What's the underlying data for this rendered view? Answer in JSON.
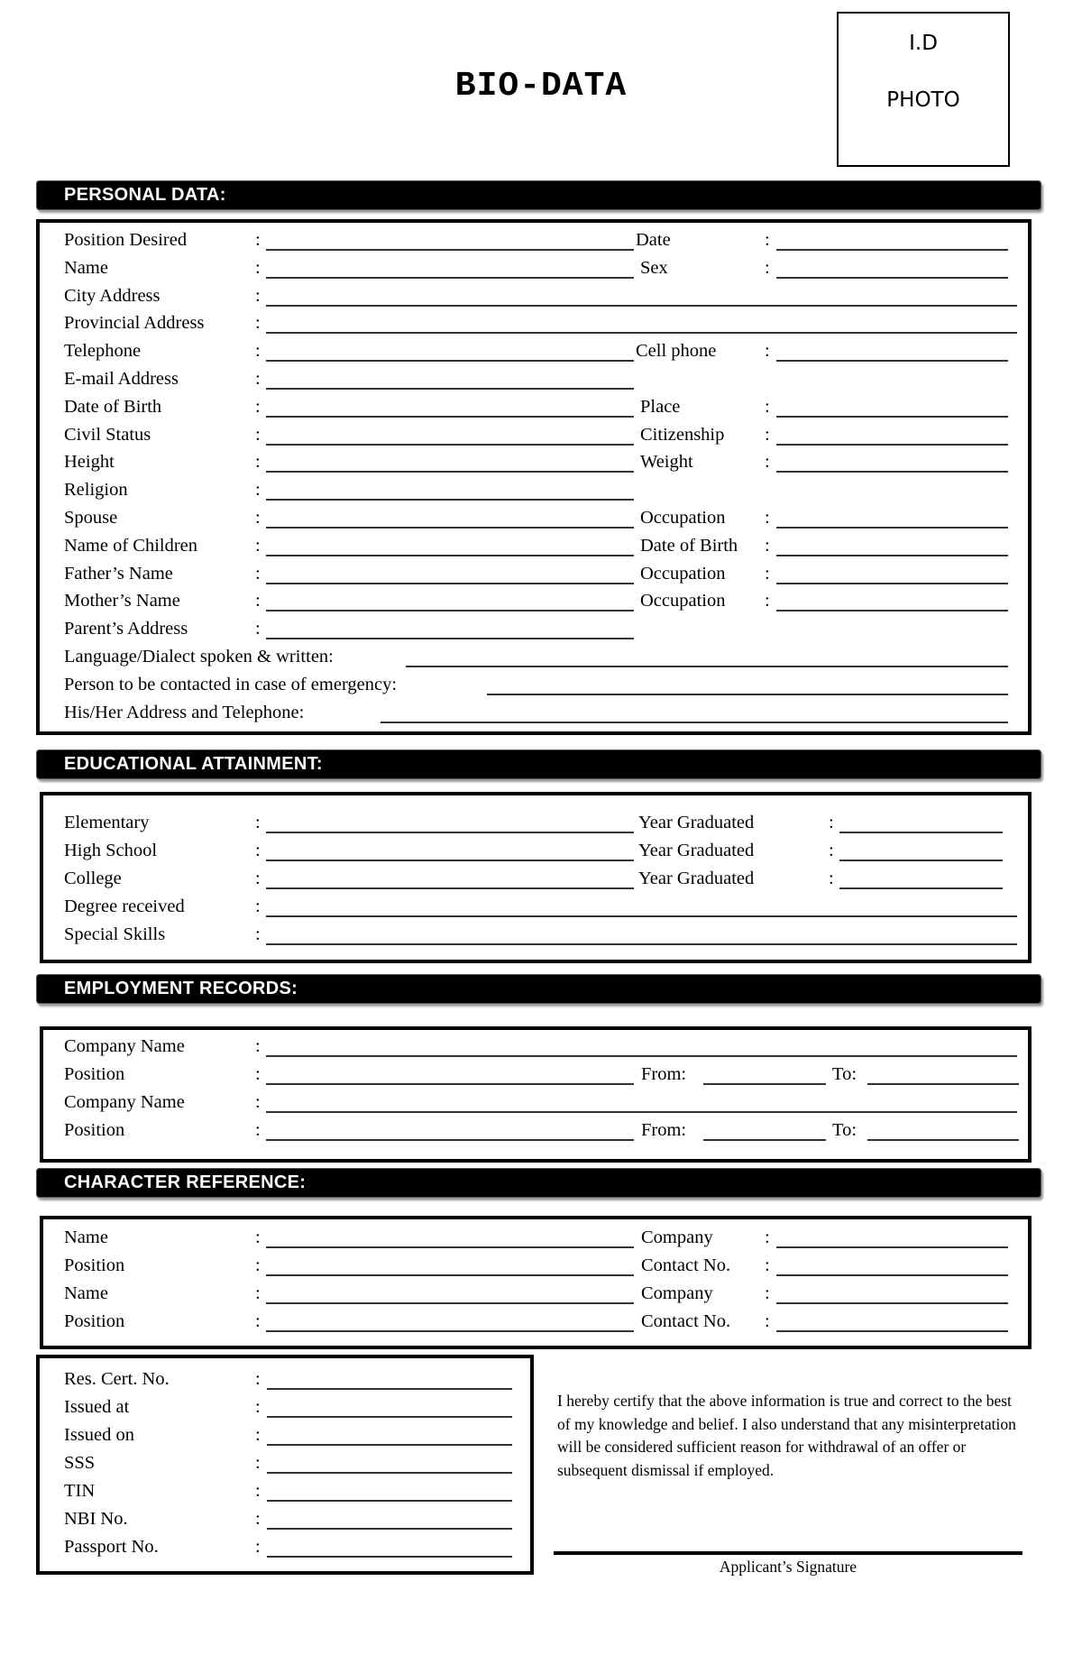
{
  "header": {
    "title": "BIO-DATA",
    "photo_line1": "I.D",
    "photo_line2": "PHOTO"
  },
  "sections": {
    "personal": "PERSONAL DATA:",
    "education": "EDUCATIONAL ATTAINMENT:",
    "employment": "EMPLOYMENT RECORDS:",
    "character": "CHARACTER REFERENCE:"
  },
  "personal": {
    "rows": [
      {
        "left": "Position Desired",
        "right": "Date"
      },
      {
        "left": "Name",
        "right": "Sex"
      },
      {
        "left": "City Address",
        "right": null
      },
      {
        "left": "Provincial Address",
        "right": null
      },
      {
        "left": "Telephone",
        "right": "Cell phone"
      },
      {
        "left": "E-mail Address",
        "right": null
      },
      {
        "left": "Date of Birth",
        "right": "Place"
      },
      {
        "left": "Civil Status",
        "right": "Citizenship"
      },
      {
        "left": "Height",
        "right": "Weight"
      },
      {
        "left": "Religion",
        "right": null
      },
      {
        "left": "Spouse",
        "right": "Occupation"
      },
      {
        "left": "Name of Children",
        "right": "Date of Birth"
      },
      {
        "left": "Father’s Name",
        "right": "Occupation"
      },
      {
        "left": "Mother’s Name",
        "right": "Occupation"
      },
      {
        "left": "Parent’s Address",
        "right": null
      }
    ],
    "long_rows": [
      "Language/Dialect spoken & written:",
      "Person to be contacted in case of emergency:",
      "His/Her Address and Telephone:"
    ]
  },
  "education": {
    "rows": [
      {
        "left": "Elementary",
        "right": "Year Graduated"
      },
      {
        "left": "High School",
        "right": "Year Graduated"
      },
      {
        "left": "College",
        "right": "Year Graduated"
      },
      {
        "left": "Degree received",
        "right": null
      },
      {
        "left": "Special Skills",
        "right": null
      }
    ]
  },
  "employment": {
    "rows": [
      {
        "left": "Company Name",
        "from": null,
        "to": null
      },
      {
        "left": "Position",
        "from": "From:",
        "to": "To:"
      },
      {
        "left": "Company Name",
        "from": null,
        "to": null
      },
      {
        "left": "Position",
        "from": "From:",
        "to": "To:"
      }
    ]
  },
  "character": {
    "rows": [
      {
        "left": "Name",
        "right": "Company"
      },
      {
        "left": "Position",
        "right": "Contact No."
      },
      {
        "left": "Name",
        "right": "Company"
      },
      {
        "left": "Position",
        "right": "Contact No."
      }
    ]
  },
  "ids": {
    "rows": [
      "Res. Cert. No.",
      "Issued at",
      "Issued on",
      "SSS",
      "TIN",
      "NBI No.",
      "Passport No."
    ]
  },
  "certification": {
    "text": "I hereby certify that the above information is true and correct to the best of my knowledge and belief. I also understand that any misinterpretation will be considered sufficient reason for withdrawal of an offer or subsequent dismissal if employed.",
    "signature_caption": "Applicant’s Signature"
  }
}
